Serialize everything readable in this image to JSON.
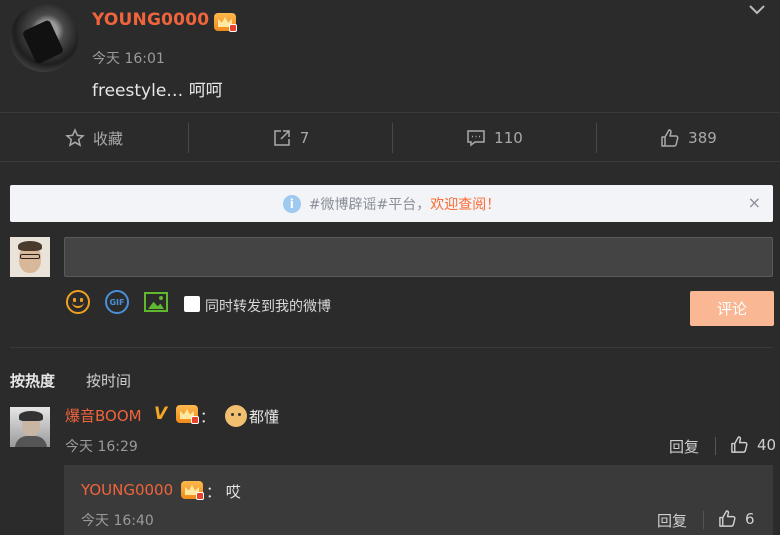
{
  "post": {
    "author": "YOUNG0000",
    "time": "今天 16:01",
    "text": "freestyle… 呵呵"
  },
  "actions": {
    "favorite_label": "收藏",
    "repost_count": "7",
    "comment_count": "110",
    "like_count": "389"
  },
  "notice": {
    "prefix": "#微博辟谣#平台，",
    "link": "欢迎查阅！",
    "close": "×"
  },
  "composer": {
    "input_value": "",
    "repost_label": "同时转发到我的微博",
    "submit_label": "评论"
  },
  "sort": {
    "hot": "按热度",
    "time": "按时间"
  },
  "comments": [
    {
      "author": "爆音BOOM",
      "verified_mark": "V",
      "text": "都懂",
      "separator": "：",
      "time": "今天 16:29",
      "reply_label": "回复",
      "likes": "40",
      "replies": [
        {
          "author": "YOUNG0000",
          "separator": "：",
          "text": "哎",
          "time": "今天 16:40",
          "reply_label": "回复",
          "likes": "6"
        }
      ]
    }
  ],
  "colors": {
    "background": "#2b2b2b",
    "username": "#f0643c",
    "submit_button": "#fab794",
    "notice_link": "#ff6a32"
  }
}
